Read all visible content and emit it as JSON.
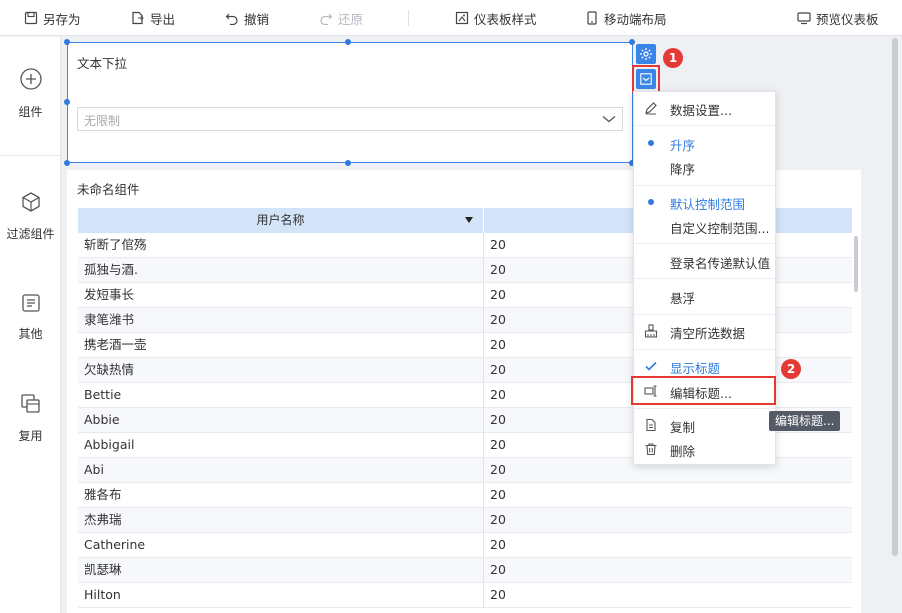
{
  "toolbar": {
    "save_as": "另存为",
    "export": "导出",
    "undo": "撤销",
    "redo": "还原",
    "dashboard_style": "仪表板样式",
    "mobile_layout": "移动端布局",
    "preview": "预览仪表板"
  },
  "sidebar": {
    "items": [
      {
        "label": "组件",
        "icon": "plus-circle-icon"
      },
      {
        "label": "过滤组件",
        "icon": "cube-icon"
      },
      {
        "label": "其他",
        "icon": "document-icon"
      },
      {
        "label": "复用",
        "icon": "reuse-icon"
      }
    ]
  },
  "filter_widget": {
    "title": "文本下拉",
    "placeholder": "无限制"
  },
  "table_widget": {
    "title": "未命名组件",
    "columns": [
      "用户名称",
      ""
    ],
    "rows": [
      [
        "斩断了倌殇",
        "20"
      ],
      [
        "孤独与酒.",
        "20"
      ],
      [
        "发短事长",
        "20"
      ],
      [
        "隶笔潍书",
        "20"
      ],
      [
        "携老酒一壶",
        "20"
      ],
      [
        "欠缺热情",
        "20"
      ],
      [
        "Bettie",
        "20"
      ],
      [
        "Abbie",
        "20"
      ],
      [
        "Abbigail",
        "20"
      ],
      [
        "Abi",
        "20"
      ],
      [
        "雅各布",
        "20"
      ],
      [
        "杰弗瑞",
        "20"
      ],
      [
        "Catherine",
        "20"
      ],
      [
        "凯瑟琳",
        "20"
      ],
      [
        "Hilton",
        "20"
      ]
    ]
  },
  "menu": {
    "data_settings": "数据设置...",
    "ascending": "升序",
    "descending": "降序",
    "default_range": "默认控制范围",
    "custom_range": "自定义控制范围...",
    "login_default": "登录名传递默认值",
    "float": "悬浮",
    "clear_selected": "清空所选数据",
    "show_title": "显示标题",
    "edit_title": "编辑标题...",
    "copy": "复制",
    "delete": "删除"
  },
  "tooltip": "编辑标题...",
  "badges": [
    "1",
    "2"
  ],
  "colors": {
    "accent": "#3a86e8",
    "highlight": "#e53935",
    "header_bg": "#d3e3f8"
  }
}
